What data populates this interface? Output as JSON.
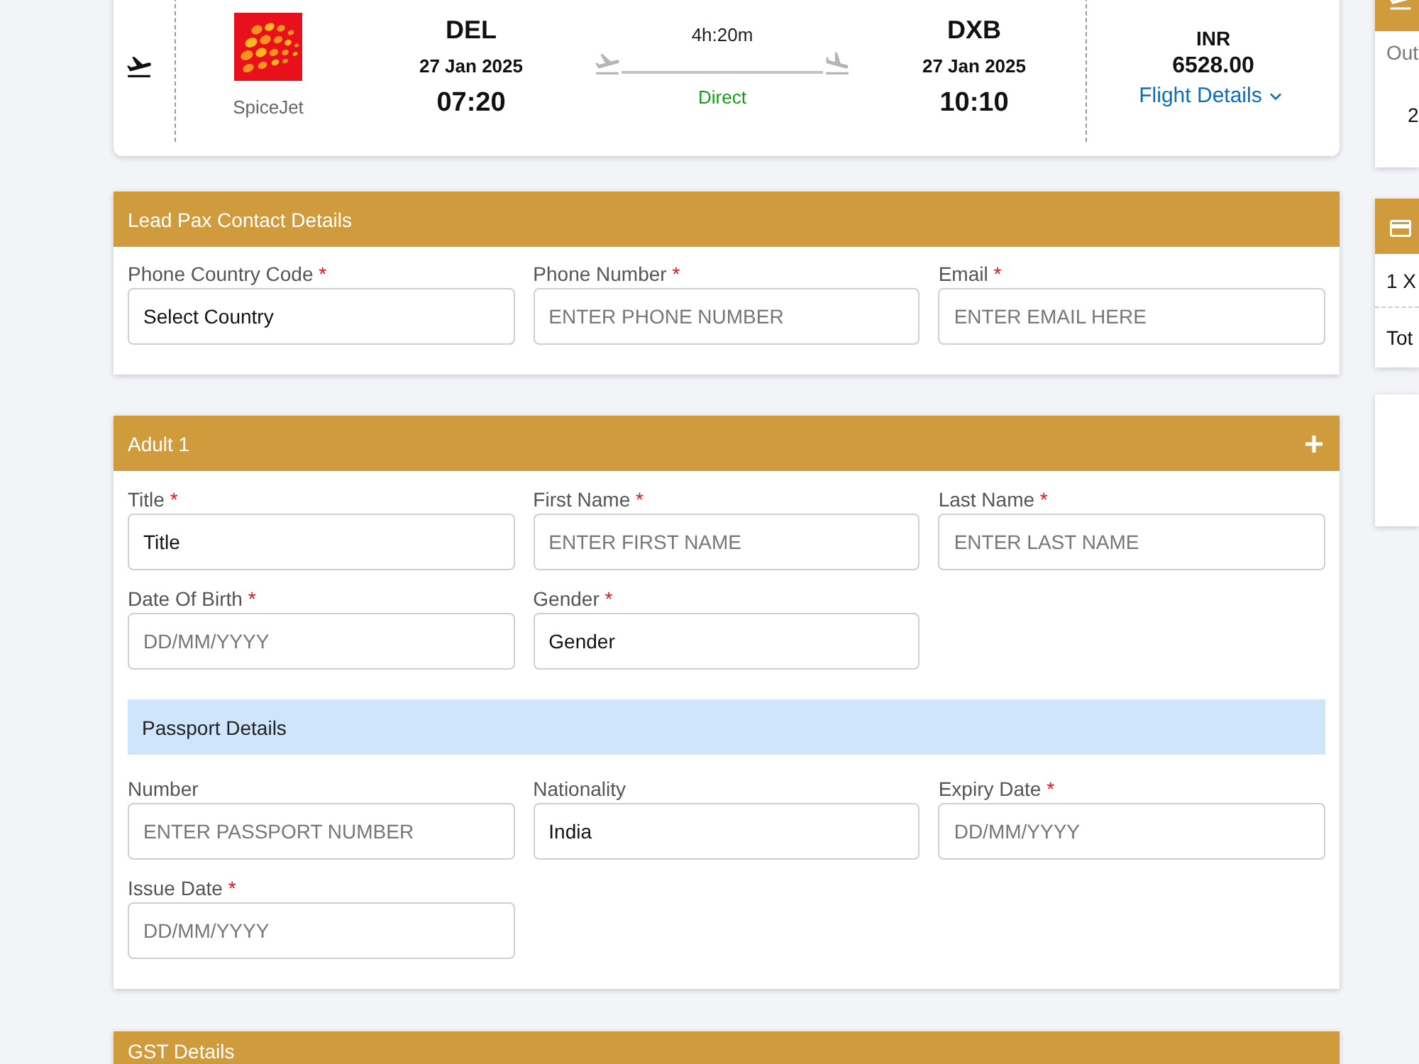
{
  "flight": {
    "airline": "SpiceJet",
    "origin": {
      "code": "DEL",
      "date": "27 Jan 2025",
      "time": "07:20"
    },
    "duration": "4h:20m",
    "stops": "Direct",
    "destination": {
      "code": "DXB",
      "date": "27 Jan 2025",
      "time": "10:10"
    },
    "currency": "INR",
    "price": "6528.00",
    "details_link": "Flight Details"
  },
  "contact": {
    "title": "Lead Pax Contact Details",
    "fields": [
      {
        "label": "Phone Country Code",
        "required_mark": "*",
        "kind": "select",
        "value": "Select Country"
      },
      {
        "label": "Phone Number",
        "required_mark": "*",
        "kind": "input",
        "placeholder": "ENTER PHONE NUMBER"
      },
      {
        "label": "Email",
        "required_mark": "*",
        "kind": "input",
        "placeholder": "ENTER EMAIL HERE"
      }
    ]
  },
  "passenger": {
    "title": "Adult 1",
    "fields": [
      {
        "label": "Title",
        "required_mark": "*",
        "kind": "select",
        "value": "Title"
      },
      {
        "label": "First Name",
        "required_mark": "*",
        "kind": "input",
        "placeholder": "ENTER FIRST NAME"
      },
      {
        "label": "Last Name",
        "required_mark": "*",
        "kind": "input",
        "placeholder": "ENTER LAST NAME"
      },
      {
        "label": "Date Of Birth",
        "required_mark": "*",
        "kind": "input",
        "placeholder": "DD/MM/YYYY"
      },
      {
        "label": "Gender",
        "required_mark": "*",
        "kind": "select",
        "value": "Gender"
      }
    ],
    "passport": {
      "title": "Passport Details",
      "fields": [
        {
          "label": "Number",
          "kind": "input",
          "placeholder": "ENTER PASSPORT NUMBER"
        },
        {
          "label": "Nationality",
          "kind": "select",
          "value": "India"
        },
        {
          "label": "Expiry Date",
          "required_mark": "*",
          "kind": "input",
          "placeholder": "DD/MM/YYYY"
        },
        {
          "label": "Issue Date",
          "required_mark": "*",
          "kind": "input",
          "placeholder": "DD/MM/YYYY"
        }
      ]
    }
  },
  "gst": {
    "title": "GST Details"
  },
  "summary_cards": [
    {
      "kind": "trip",
      "lines": [
        "Out",
        "2"
      ]
    },
    {
      "kind": "fare",
      "lines": [
        "1 X",
        "Tot"
      ]
    },
    {
      "kind": "blank"
    }
  ]
}
